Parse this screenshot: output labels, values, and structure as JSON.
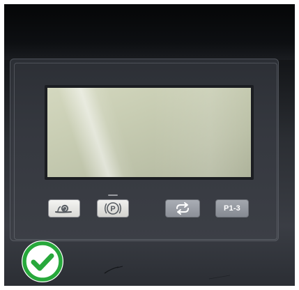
{
  "panel": {
    "buttons": [
      {
        "icon": "snail-icon"
      },
      {
        "icon": "parking-brake-icon",
        "label": "(P)"
      },
      {
        "icon": "cycle-arrows-icon"
      },
      {
        "icon": "program-icon",
        "label": "P1-3"
      }
    ]
  },
  "badge": {
    "icon": "check-circle-icon",
    "color": "#27a83b"
  },
  "colors": {
    "lcd": "#c8cdb3",
    "panel": "#35383f"
  }
}
